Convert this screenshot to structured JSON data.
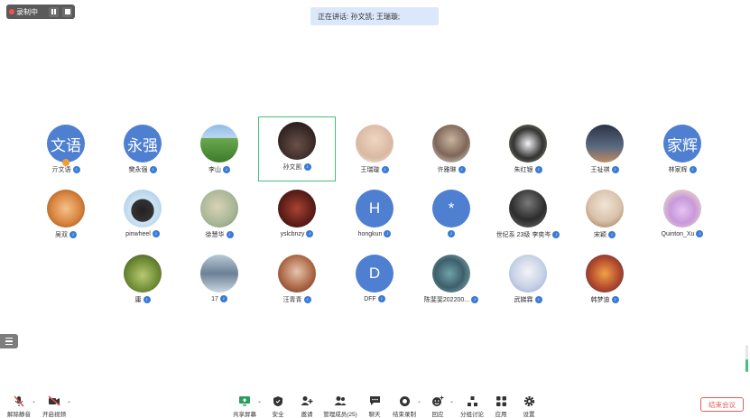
{
  "recording": {
    "label": "录制中"
  },
  "speaking": {
    "text": "正在讲话: 孙文凯; 王瑞璇;"
  },
  "participants": [
    {
      "name": "亓文语",
      "avatar_text": "文语",
      "host": true,
      "avatar_color": "#4e7fd1"
    },
    {
      "name": "樊永强",
      "avatar_text": "永强",
      "avatar_color": "#4e7fd1"
    },
    {
      "name": "李山",
      "avatar_text": ""
    },
    {
      "name": "孙文凯",
      "avatar_text": "",
      "active": true
    },
    {
      "name": "王瑞璇",
      "avatar_text": ""
    },
    {
      "name": "许雅琳",
      "avatar_text": ""
    },
    {
      "name": "朱红银",
      "avatar_text": ""
    },
    {
      "name": "王祉祺",
      "avatar_text": ""
    },
    {
      "name": "林家辉",
      "avatar_text": "家辉",
      "avatar_color": "#4e7fd1"
    },
    {
      "name": "吴双",
      "avatar_text": ""
    },
    {
      "name": "pinwheel",
      "avatar_text": ""
    },
    {
      "name": "徐慧华",
      "avatar_text": ""
    },
    {
      "name": "yslcbnzy",
      "avatar_text": ""
    },
    {
      "name": "hongkun",
      "avatar_text": "H",
      "avatar_color": "#4e7fd1"
    },
    {
      "name": "",
      "avatar_text": "*",
      "avatar_color": "#4e7fd1"
    },
    {
      "name": "世纪系 23级 李奕岑",
      "avatar_text": ""
    },
    {
      "name": "宋颖",
      "avatar_text": ""
    },
    {
      "name": "Quinton_Xu",
      "avatar_text": ""
    },
    {
      "name": "庸",
      "avatar_text": ""
    },
    {
      "name": "17",
      "avatar_text": ""
    },
    {
      "name": "汪青青",
      "avatar_text": ""
    },
    {
      "name": "DFF",
      "avatar_text": "D",
      "avatar_color": "#4e7fd1"
    },
    {
      "name": "陈斐斐202200...",
      "avatar_text": ""
    },
    {
      "name": "武娣霖",
      "avatar_text": ""
    },
    {
      "name": "韩梦迪",
      "avatar_text": ""
    }
  ],
  "toolbar": {
    "unmute": "解除静音",
    "start_video": "开启视频",
    "share_screen": "共享屏幕",
    "security": "安全",
    "invite": "邀请",
    "manage_members": "管理成员(25)",
    "chat": "聊天",
    "end_recording": "结束录制",
    "reactions": "回应",
    "breakout": "分组讨论",
    "apps": "应用",
    "settings": "设置",
    "end_meeting": "结束会议"
  },
  "colors": {
    "active_border": "#3fc27b",
    "badge": "#3a7bd5",
    "avatar_default": "#4e7fd1",
    "end_meeting": "#e85b5b"
  },
  "icons": [
    "mic-muted-icon",
    "video-off-icon",
    "share-screen-icon",
    "shield-icon",
    "invite-icon",
    "members-icon",
    "chat-icon",
    "record-stop-icon",
    "reaction-icon",
    "breakout-icon",
    "apps-icon",
    "gear-icon"
  ]
}
